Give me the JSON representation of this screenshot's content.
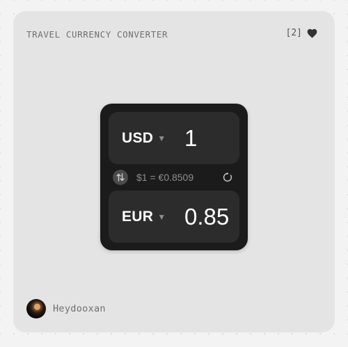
{
  "card": {
    "title": "TRAVEL CURRENCY CONVERTER",
    "like_count": "[2]",
    "like_icon": "heart-icon"
  },
  "converter": {
    "from": {
      "currency": "USD",
      "amount": "1"
    },
    "to": {
      "currency": "EUR",
      "amount": "0.85"
    },
    "rate_text": "$1 = €0.8509",
    "swap_icon": "swap-vertical-icon",
    "refresh_icon": "refresh-icon",
    "caret_icon": "▼"
  },
  "author": {
    "name": "Heydooxan"
  },
  "colors": {
    "page_bg": "#f3f3f3",
    "card_bg": "#e4e4e4",
    "widget_bg": "#1b1b1b",
    "row_bg": "#2c2c2c",
    "text_primary": "#ffffff",
    "text_muted": "#8e8e8e"
  }
}
